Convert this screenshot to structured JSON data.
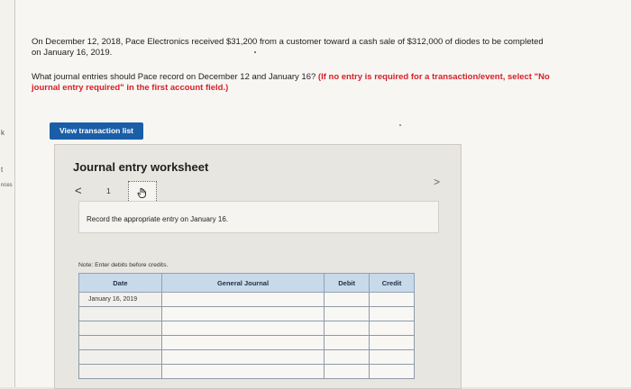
{
  "sidebar": {
    "fragments": [
      "k",
      "t",
      "nces"
    ]
  },
  "question": {
    "line1": "On December 12, 2018, Pace Electronics received $31,200 from a customer toward a cash sale of $312,000 of diodes to be completed",
    "line2": "on January 16, 2019.",
    "prompt": "What journal entries should Pace record on December 12 and January 16? ",
    "instruction_line1": "(If no entry is required for a transaction/event, select \"No",
    "instruction_line2": "journal entry required\" in the first account field.)"
  },
  "buttons": {
    "view_transaction_list": "View transaction list"
  },
  "worksheet": {
    "title": "Journal entry worksheet",
    "nav_prev": "<",
    "nav_next": ">",
    "page_number": "1",
    "record_instruction": "Record the appropriate entry on January 16.",
    "note": "Note: Enter debits before credits.",
    "table": {
      "headers": [
        "Date",
        "General Journal",
        "Debit",
        "Credit"
      ],
      "rows": [
        [
          "January 16, 2019",
          "",
          "",
          ""
        ],
        [
          "",
          "",
          "",
          ""
        ],
        [
          "",
          "",
          "",
          ""
        ],
        [
          "",
          "",
          "",
          ""
        ],
        [
          "",
          "",
          "",
          ""
        ],
        [
          "",
          "",
          "",
          ""
        ]
      ]
    }
  }
}
